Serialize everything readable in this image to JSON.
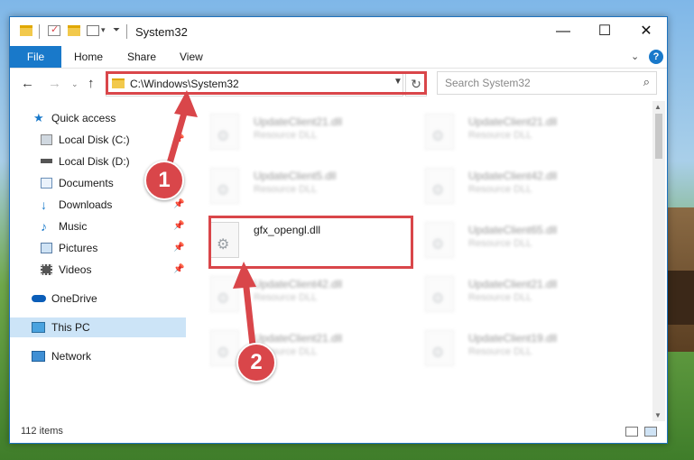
{
  "window": {
    "title": "System32",
    "controls": {
      "minimize": "—",
      "maximize": "☐",
      "close": "✕"
    }
  },
  "ribbon": {
    "tabs": [
      "File",
      "Home",
      "Share",
      "View"
    ],
    "help": "?"
  },
  "address": {
    "path": "C:\\Windows\\System32",
    "search_placeholder": "Search System32"
  },
  "nav": {
    "items": [
      {
        "label": "Quick access",
        "icon": "star-icon"
      },
      {
        "label": "Local Disk (C:)",
        "icon": "drive-icon"
      },
      {
        "label": "Local Disk (D:)",
        "icon": "drive-icon"
      },
      {
        "label": "Documents",
        "icon": "documents-icon"
      },
      {
        "label": "Downloads",
        "icon": "download-icon"
      },
      {
        "label": "Music",
        "icon": "music-icon"
      },
      {
        "label": "Pictures",
        "icon": "pictures-icon"
      },
      {
        "label": "Videos",
        "icon": "videos-icon"
      },
      {
        "label": "OneDrive",
        "icon": "cloud-icon"
      },
      {
        "label": "This PC",
        "icon": "computer-icon"
      },
      {
        "label": "Network",
        "icon": "network-icon"
      }
    ]
  },
  "files": {
    "left": [
      {
        "name": "UpdateClient21.dll",
        "type": "Resource DLL"
      },
      {
        "name": "UpdateClient5.dll",
        "type": "Resource DLL"
      },
      {
        "name": "gfx_opengl.dll",
        "type": ""
      },
      {
        "name": "UpdateClient42.dll",
        "type": "Resource DLL"
      },
      {
        "name": "UpdateClient21.dll",
        "type": "Resource DLL"
      }
    ],
    "right": [
      {
        "name": "UpdateClient21.dll",
        "type": "Resource DLL"
      },
      {
        "name": "UpdateClient42.dll",
        "type": "Resource DLL"
      },
      {
        "name": "UpdateClient65.dll",
        "type": "Resource DLL"
      },
      {
        "name": "UpdateClient21.dll",
        "type": "Resource DLL"
      },
      {
        "name": "UpdateClient19.dll",
        "type": "Resource DLL"
      }
    ]
  },
  "status": {
    "item_count": "112 items"
  },
  "annotations": {
    "step1": "1",
    "step2": "2",
    "color": "#d9464a"
  }
}
